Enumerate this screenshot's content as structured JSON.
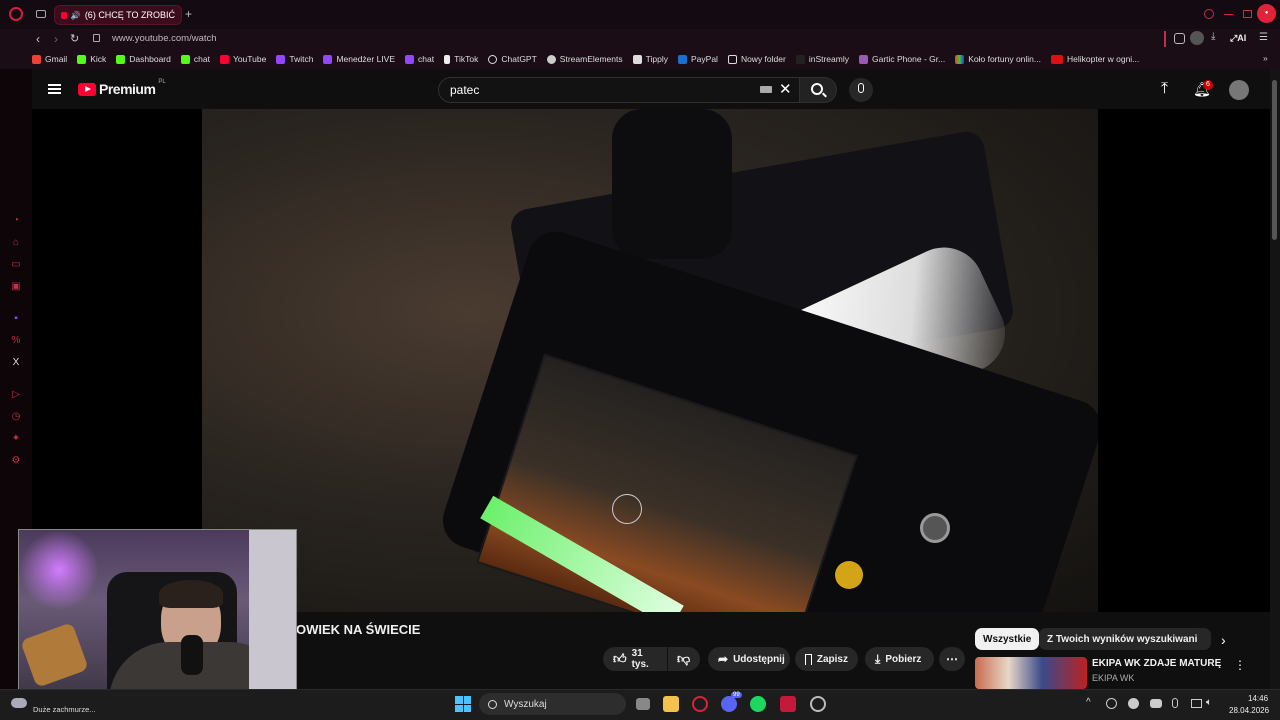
{
  "browser": {
    "tab_title": "(6) CHCĘ TO ZROBIĆ",
    "url": "www.youtube.com/watch",
    "ai_label": "AI",
    "bookmarks": [
      "Gmail",
      "Kick",
      "Dashboard",
      "chat",
      "YouTube",
      "Twitch",
      "Menedżer LIVE",
      "chat",
      "TikTok",
      "ChatGPT",
      "StreamElements",
      "Tipply",
      "PayPal",
      "Nowy folder",
      "inStreamly",
      "Gartic Phone - Gr...",
      "Koło fortuny onlin...",
      "Helikopter w ogni..."
    ]
  },
  "youtube": {
    "logo_text": "Premium",
    "logo_region": "PL",
    "search_value": "patec",
    "notification_count": "6",
    "video_title": "OWIEK NA ŚWIECIE",
    "actions": {
      "likes": "31 tys.",
      "share": "Udostępnij",
      "save": "Zapisz",
      "download": "Pobierz"
    },
    "chips": [
      "Wszystkie",
      "Z Twoich wyników wyszukiwania"
    ],
    "recommended": {
      "title": "EKIPA WK ZDAJE MATURĘ",
      "channel": "EKIPA WK"
    }
  },
  "taskbar": {
    "status_text": "Duże zachmurze...",
    "search_label": "Wyszukaj",
    "time": "14:46",
    "date": "28.04.2026",
    "discord_badge": "99"
  },
  "colors": {
    "accent": "#ff0033",
    "opera_red": "#c33045"
  }
}
